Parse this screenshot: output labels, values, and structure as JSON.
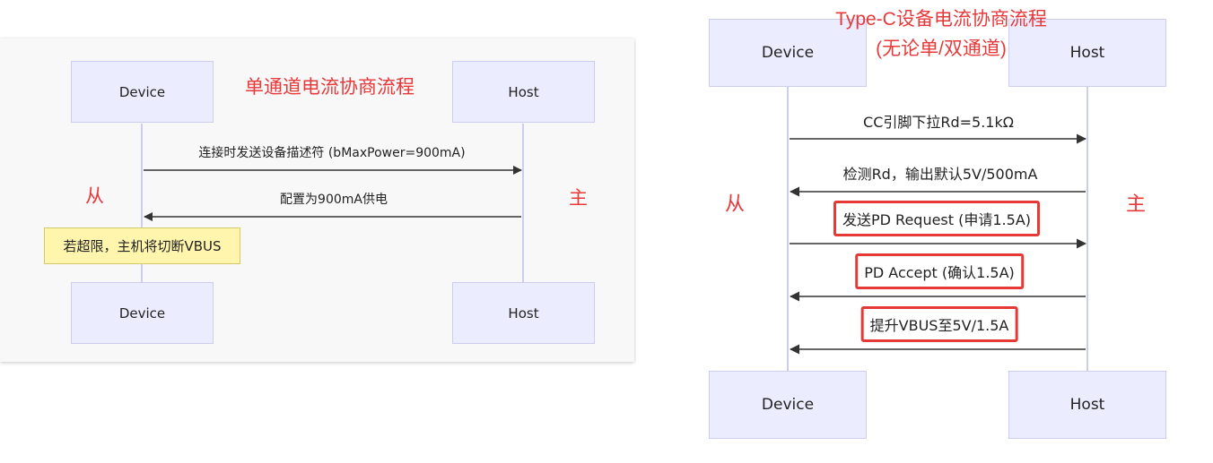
{
  "left": {
    "title": "单通道电流协商流程",
    "actor_device": "Device",
    "actor_host": "Host",
    "slave_label": "从",
    "master_label": "主",
    "messages": [
      "连接时发送设备描述符 (bMaxPower=900mA)",
      "配置为900mA供电"
    ],
    "note": "若超限，主机将切断VBUS"
  },
  "right": {
    "title_line1": "Type-C设备电流协商流程",
    "title_line2": "(无论单/双通道)",
    "actor_device": "Device",
    "actor_host": "Host",
    "slave_label": "从",
    "master_label": "主",
    "messages": [
      "CC引脚下拉Rd=5.1kΩ",
      "检测Rd，输出默认5V/500mA",
      "发送PD Request (申请1.5A)",
      "PD Accept (确认1.5A)",
      "提升VBUS至5V/1.5A"
    ]
  },
  "colors": {
    "actor_fill": "#ececff",
    "note_fill": "#fff5ad",
    "highlight": "#e53935",
    "label_red": "#e8393a"
  }
}
